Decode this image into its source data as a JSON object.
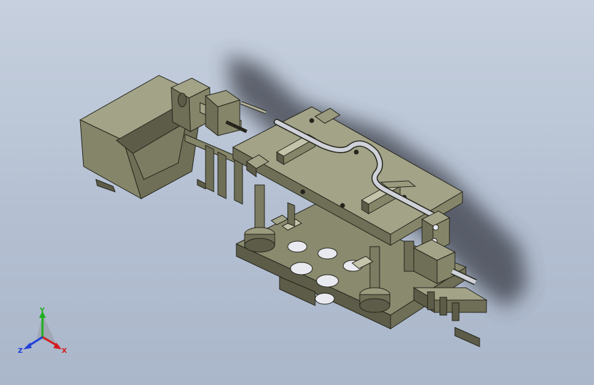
{
  "viewport": {
    "background_top": "#c6d0de",
    "background_bottom": "#aab6c9"
  },
  "model": {
    "parts": [
      "feed-bin",
      "stepper-motor",
      "lead-screw-shaft",
      "base-plate",
      "top-plate",
      "guide-columns",
      "bent-feed-rod",
      "clamp-blocks",
      "sensor-block",
      "right-end-bracket"
    ],
    "colors": {
      "body": "#858569",
      "body_light": "#a3a388",
      "body_dark": "#5c5c48",
      "edge": "#24241c",
      "shadow": "#3c4048"
    }
  },
  "triad": {
    "x_label": "X",
    "y_label": "Y",
    "z_label": "Z",
    "x_color": "#d41c1c",
    "y_color": "#20b020",
    "z_color": "#2040d8"
  }
}
